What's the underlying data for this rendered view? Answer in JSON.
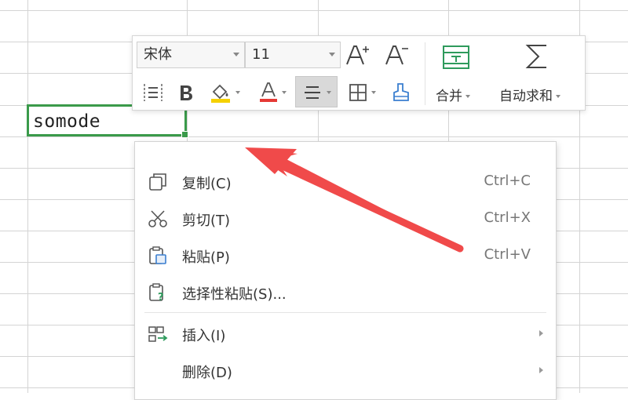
{
  "sheet": {
    "selected_cell_text": "somode",
    "grid_color": "#d4d4d4",
    "selection_color": "#3a9a4a"
  },
  "toolbar": {
    "font_name": "宋体",
    "font_size": "11",
    "merge_label": "合并",
    "autosum_label": "自动求和",
    "icons": [
      "increase-font-icon",
      "decrease-font-icon",
      "format-painter-icon",
      "bold-icon",
      "fill-color-icon",
      "font-color-icon",
      "align-icon",
      "borders-icon",
      "clear-icon",
      "merge-icon",
      "sum-icon"
    ],
    "font_color": "#e53935",
    "fill_color": "#f5d100"
  },
  "context_menu": {
    "items": [
      {
        "label": "复制(C)",
        "shortcut": "Ctrl+C",
        "icon": "copy-icon"
      },
      {
        "label": "剪切(T)",
        "shortcut": "Ctrl+X",
        "icon": "cut-icon"
      },
      {
        "label": "粘贴(P)",
        "shortcut": "Ctrl+V",
        "icon": "paste-icon"
      },
      {
        "label": "选择性粘贴(S)...",
        "shortcut": "",
        "icon": "paste-special-icon"
      },
      {
        "label": "插入(I)",
        "shortcut": "",
        "icon": "insert-icon",
        "submenu": true
      },
      {
        "label": "删除(D)",
        "shortcut": "",
        "icon": "",
        "submenu": true
      }
    ]
  },
  "annotation": {
    "arrow_color": "#f04a4a"
  }
}
